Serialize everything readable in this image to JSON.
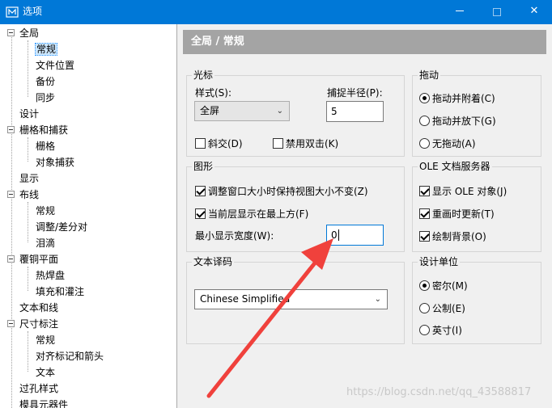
{
  "window": {
    "title": "选项",
    "minimize": "—",
    "close": "✕",
    "colors": {
      "titlebar": "#0078d7",
      "header": "#a4a4a4",
      "annotation_arrow": "#f0413c"
    }
  },
  "tree": {
    "items": [
      {
        "label": "全局",
        "expanded": true
      },
      {
        "label": "常规",
        "selected": true
      },
      {
        "label": "文件位置"
      },
      {
        "label": "备份"
      },
      {
        "label": "同步"
      },
      {
        "label": "设计"
      },
      {
        "label": "栅格和捕获",
        "expanded": true
      },
      {
        "label": "栅格"
      },
      {
        "label": "对象捕获"
      },
      {
        "label": "显示"
      },
      {
        "label": "布线",
        "expanded": true
      },
      {
        "label": "常规"
      },
      {
        "label": "调整/差分对"
      },
      {
        "label": "泪滴"
      },
      {
        "label": "覆铜平面",
        "expanded": true
      },
      {
        "label": "热焊盘"
      },
      {
        "label": "填充和灌注"
      },
      {
        "label": "文本和线"
      },
      {
        "label": "尺寸标注",
        "expanded": true
      },
      {
        "label": "常规"
      },
      {
        "label": "对齐标记和箭头"
      },
      {
        "label": "文本"
      },
      {
        "label": "过孔样式"
      },
      {
        "label": "模具元器件"
      }
    ]
  },
  "panel": {
    "header": "全局 / 常规",
    "cursor": {
      "title": "光标",
      "style_label": "样式(S):",
      "style_value": "全屏",
      "snap_label": "捕捉半径(P):",
      "snap_value": "5",
      "diagonal_label": "斜交(D)",
      "diagonal_checked": false,
      "disable_dblclick_label": "禁用双击(K)",
      "disable_dblclick_checked": false
    },
    "drag": {
      "title": "拖动",
      "options": [
        {
          "label": "拖动并附着(C)",
          "checked": true
        },
        {
          "label": "拖动并放下(G)",
          "checked": false
        },
        {
          "label": "无拖动(A)",
          "checked": false
        }
      ]
    },
    "graphics": {
      "title": "图形",
      "keep_view_label": "调整窗口大小时保持视图大小不变(Z)",
      "keep_view_checked": true,
      "top_layer_label": "当前层显示在最上方(F)",
      "top_layer_checked": true,
      "min_width_label": "最小显示宽度(W):",
      "min_width_value": "0"
    },
    "ole": {
      "title": "OLE 文档服务器",
      "options": [
        {
          "label": "显示 OLE 对象(J)",
          "checked": true
        },
        {
          "label": "重画时更新(T)",
          "checked": true
        },
        {
          "label": "绘制背景(O)",
          "checked": true
        }
      ]
    },
    "encoding": {
      "title": "文本译码",
      "value": "Chinese Simplified"
    },
    "units": {
      "title": "设计单位",
      "options": [
        {
          "label": "密尔(M)",
          "checked": true
        },
        {
          "label": "公制(E)",
          "checked": false
        },
        {
          "label": "英寸(I)",
          "checked": false
        }
      ]
    }
  },
  "watermark": "https://blog.csdn.net/qq_43588817"
}
